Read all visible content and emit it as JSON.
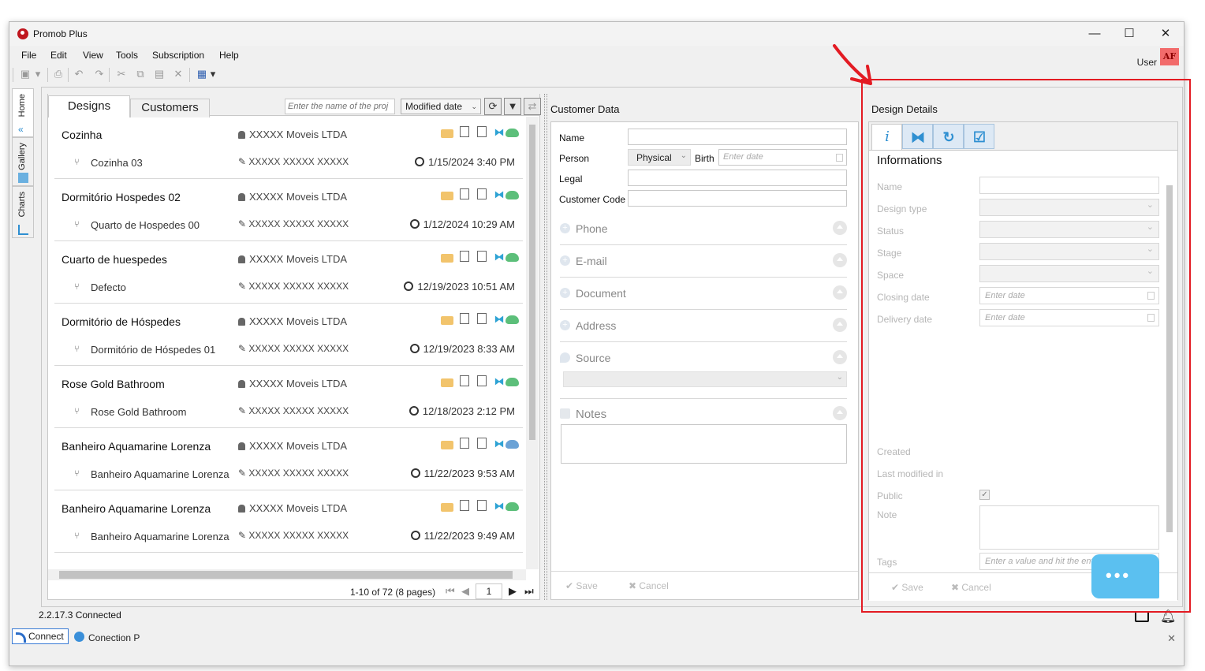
{
  "window": {
    "title": "Promob Plus"
  },
  "menu": [
    "File",
    "Edit",
    "View",
    "Tools",
    "Subscription",
    "Help"
  ],
  "user": {
    "label": "User",
    "initials": "AF"
  },
  "side_tabs": [
    "Home",
    "Gallery",
    "Charts"
  ],
  "designs_panel": {
    "tabs": [
      "Designs",
      "Customers"
    ],
    "search_placeholder": "Enter the name of the proj",
    "sort_value": "Modified date",
    "items": [
      {
        "name": "Cozinha",
        "owner": "XXXXX Moveis LTDA",
        "sub": "Cozinha 03",
        "author": "XXXXX XXXXX XXXXX",
        "date": "1/15/2024 3:40 PM",
        "cloud": "green"
      },
      {
        "name": "Dormitório Hospedes 02",
        "owner": "XXXXX Moveis LTDA",
        "sub": "Quarto de Hospedes 00",
        "author": "XXXXX XXXXX XXXXX",
        "date": "1/12/2024 10:29 AM",
        "cloud": "green"
      },
      {
        "name": "Cuarto de huespedes",
        "owner": "XXXXX Moveis LTDA",
        "sub": "Defecto",
        "author": "XXXXX XXXXX XXXXX",
        "date": "12/19/2023 10:51 AM",
        "cloud": "green"
      },
      {
        "name": "Dormitório de Hóspedes",
        "owner": "XXXXX Moveis LTDA",
        "sub": "Dormitório de Hóspedes 01",
        "author": "XXXXX XXXXX XXXXX",
        "date": "12/19/2023 8:33 AM",
        "cloud": "green"
      },
      {
        "name": "Rose Gold Bathroom",
        "owner": "XXXXX Moveis LTDA",
        "sub": "Rose Gold Bathroom",
        "author": "XXXXX XXXXX XXXXX",
        "date": "12/18/2023 2:12 PM",
        "cloud": "green"
      },
      {
        "name": "Banheiro Aquamarine Lorenza",
        "owner": "XXXXX Moveis LTDA",
        "sub": "Banheiro Aquamarine Lorenza",
        "author": "XXXXX XXXXX XXXXX",
        "date": "11/22/2023 9:53 AM",
        "cloud": "blue"
      },
      {
        "name": "Banheiro Aquamarine Lorenza",
        "owner": "XXXXX Moveis LTDA",
        "sub": "Banheiro Aquamarine Lorenza",
        "author": "XXXXX XXXXX XXXXX",
        "date": "11/22/2023 9:49 AM",
        "cloud": "green"
      }
    ],
    "pager": {
      "info": "1-10 of 72 (8 pages)",
      "page": "1"
    }
  },
  "customer_panel": {
    "title": "Customer Data",
    "labels": {
      "name": "Name",
      "person": "Person",
      "birth": "Birth",
      "legal": "Legal",
      "customer_code": "Customer Code"
    },
    "person_value": "Physical",
    "birth_placeholder": "Enter date",
    "sections": [
      "Phone",
      "E-mail",
      "Document",
      "Address",
      "Source",
      "Notes"
    ],
    "save": "Save",
    "cancel": "Cancel"
  },
  "design_details": {
    "title": "Design Details",
    "heading": "Informations",
    "labels": [
      "Name",
      "Design type",
      "Status",
      "Stage",
      "Space",
      "Closing date",
      "Delivery date"
    ],
    "date_placeholder": "Enter date",
    "created": "Created",
    "last_modified": "Last modified in",
    "public": "Public",
    "note": "Note",
    "tags": "Tags",
    "tags_placeholder": "Enter a value and hit the enter key",
    "save": "Save",
    "cancel": "Cancel"
  },
  "status": {
    "version": "2.2.17.3 Connected",
    "connect": "Connect",
    "connection": "Conection P"
  },
  "colors": {
    "highlight": "#e31b23",
    "accent": "#2e8fd1",
    "chat": "#5bc0f0"
  }
}
